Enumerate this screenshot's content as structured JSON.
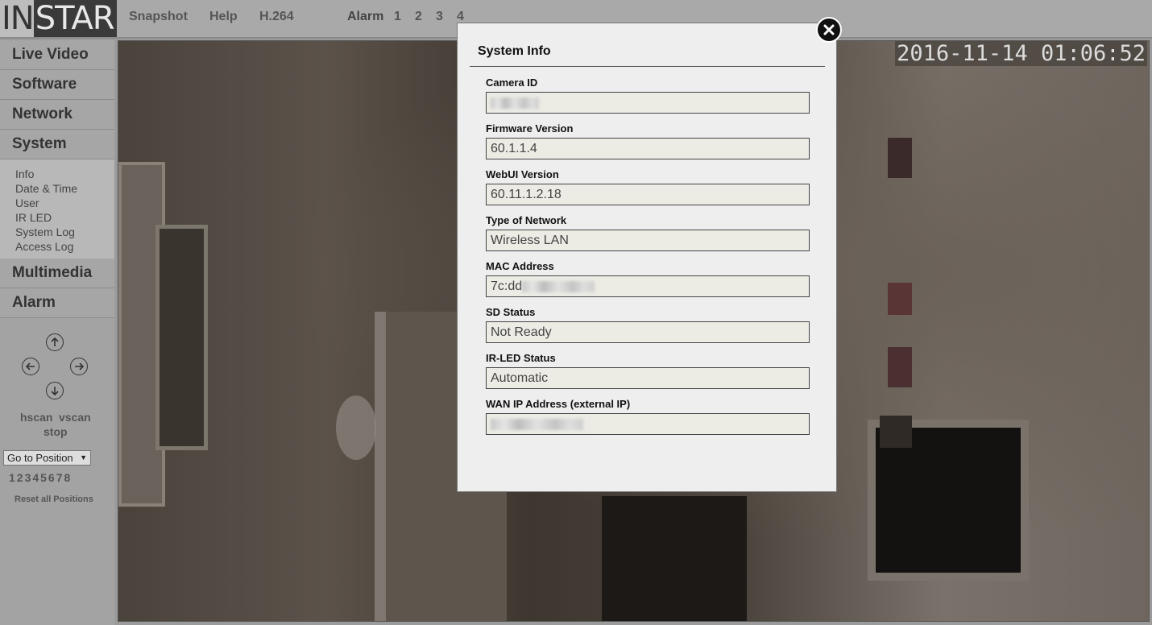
{
  "logo": {
    "part1": "IN",
    "part2": "STAR"
  },
  "topnav": {
    "snapshot": "Snapshot",
    "help": "Help",
    "h264": "H.264",
    "alarm": "Alarm",
    "alarm_numbers": [
      "1",
      "2",
      "3",
      "4"
    ]
  },
  "sidebar": {
    "items": [
      {
        "label": "Live Video"
      },
      {
        "label": "Software"
      },
      {
        "label": "Network"
      },
      {
        "label": "System"
      },
      {
        "label": "Multimedia"
      },
      {
        "label": "Alarm"
      }
    ],
    "system_submenu": [
      "Info",
      "Date & Time",
      "User",
      "IR LED",
      "System Log",
      "Access Log"
    ],
    "ptz": {
      "hscan": "hscan",
      "vscan": "vscan",
      "stop": "stop",
      "goto": "Go to Position",
      "positions": "12345678",
      "reset": "Reset all Positions"
    }
  },
  "video": {
    "timestamp": "2016-11-14 01:06:52"
  },
  "dialog": {
    "title": "System Info",
    "fields": [
      {
        "label": "Camera ID",
        "value": ""
      },
      {
        "label": "Firmware Version",
        "value": "60.1.1.4"
      },
      {
        "label": "WebUI Version",
        "value": "60.11.1.2.18"
      },
      {
        "label": "Type of Network",
        "value": "Wireless LAN"
      },
      {
        "label": "MAC Address",
        "value": "7c:dd"
      },
      {
        "label": "SD Status",
        "value": "Not Ready"
      },
      {
        "label": "IR-LED Status",
        "value": "Automatic"
      },
      {
        "label": "WAN IP Address (external IP)",
        "value": ""
      }
    ]
  },
  "colors": {
    "background": "#9b9b9b",
    "dialog_bg": "#eeeeee",
    "field_bg": "#ecebe4",
    "close_button": "#111111"
  }
}
